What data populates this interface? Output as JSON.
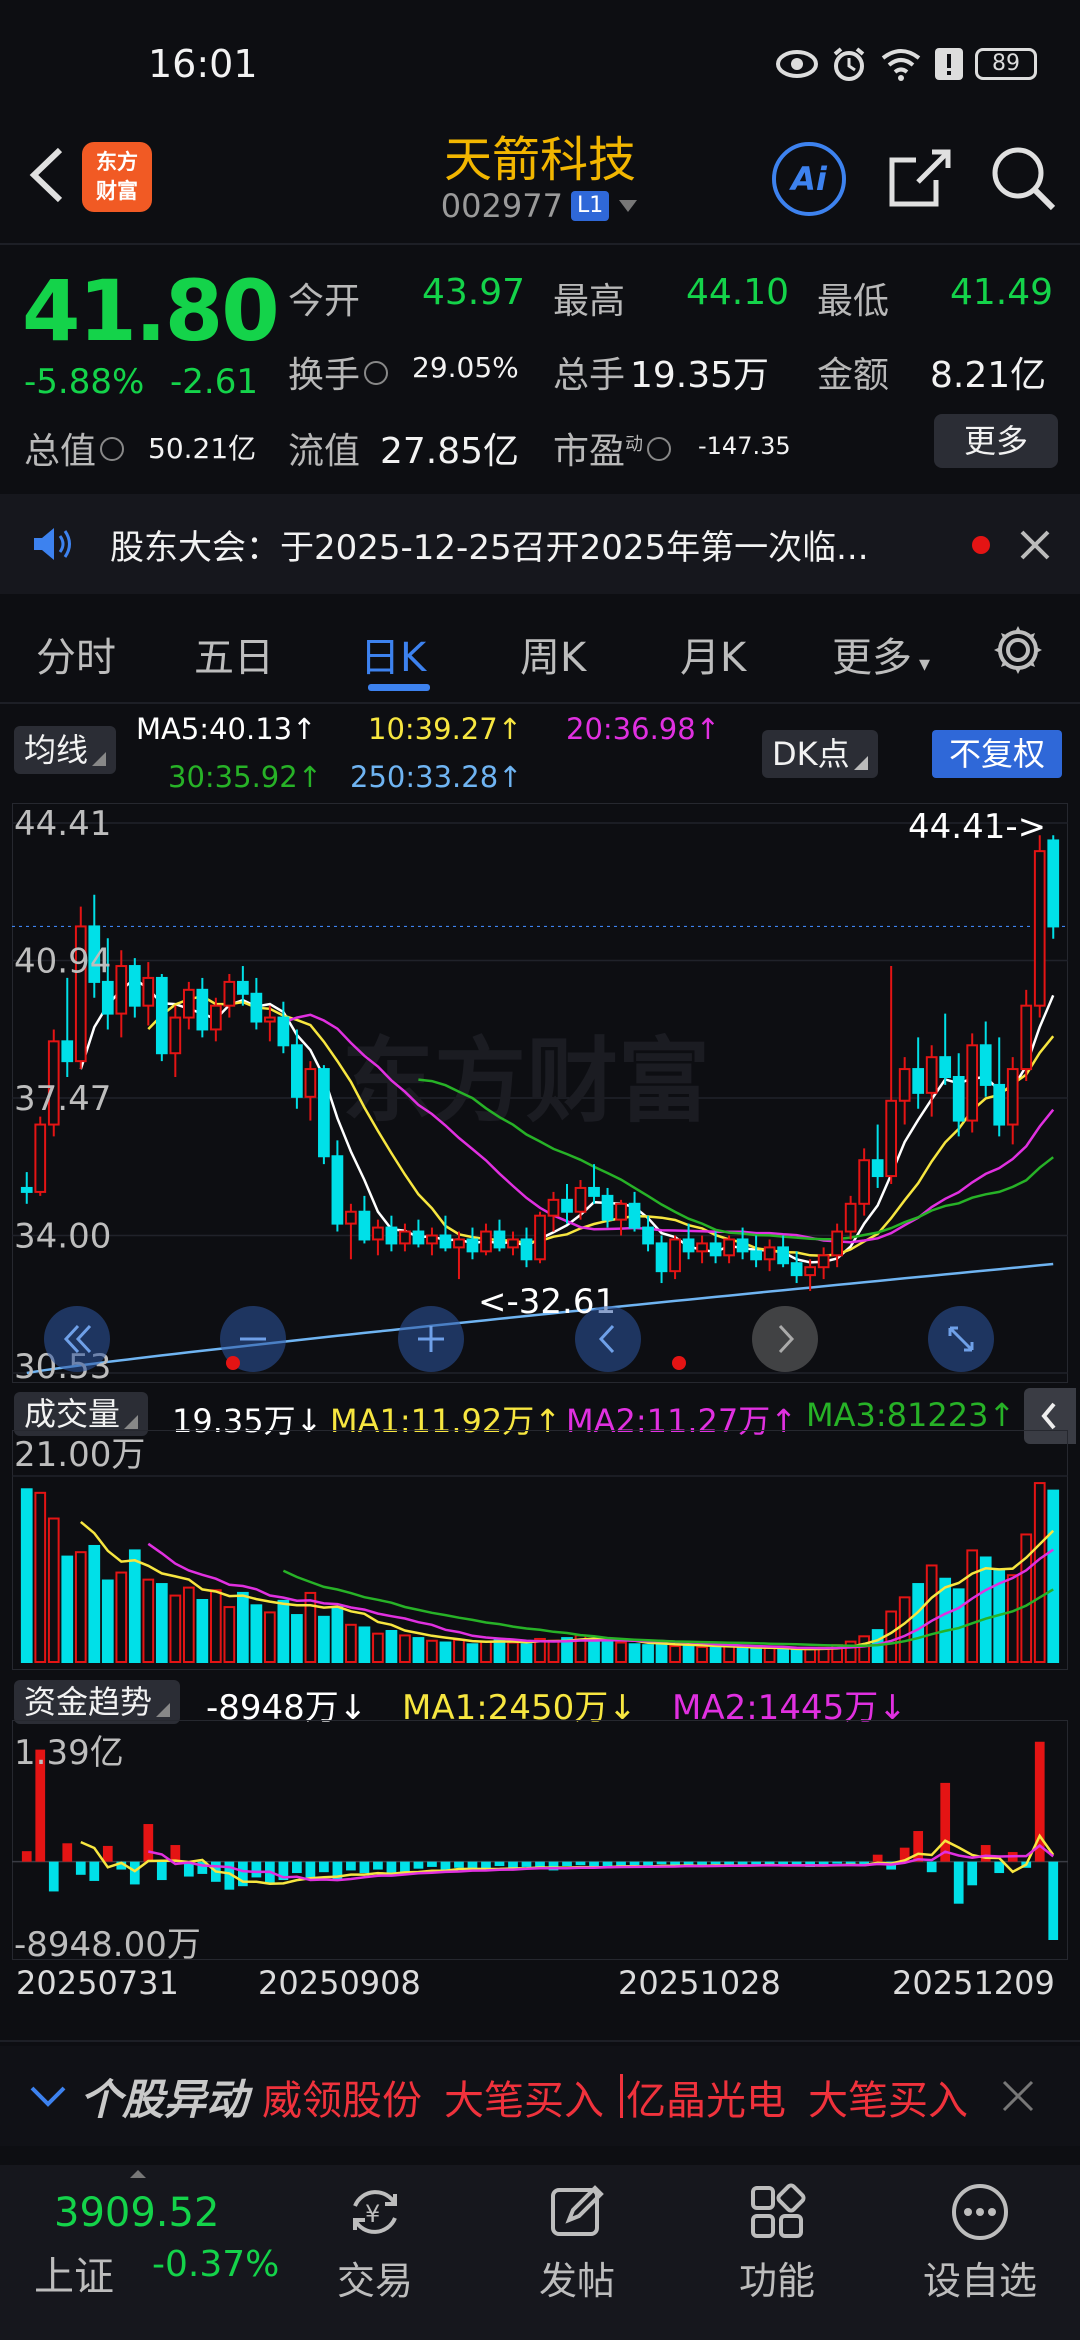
{
  "status": {
    "time": "16:01",
    "battery": "89"
  },
  "header": {
    "stock_name": "天箭科技",
    "stock_code": "002977",
    "level_badge": "L1",
    "logo_line1": "东方",
    "logo_line2": "财富",
    "ai_label": "Ai"
  },
  "quote": {
    "price": "41.80",
    "change_pct": "-5.88%",
    "change": "-2.61",
    "open_label": "今开",
    "open": "43.97",
    "high_label": "最高",
    "high": "44.10",
    "low_label": "最低",
    "low": "41.49",
    "turnover_label": "换手",
    "turnover": "29.05%",
    "volume_label": "总手",
    "volume": "19.35万",
    "amount_label": "金额",
    "amount": "8.21亿",
    "mktcap_label": "总值",
    "mktcap": "50.21亿",
    "float_label": "流值",
    "float_cap": "27.85亿",
    "pe_label": "市盈",
    "pe_sup": "动",
    "pe": "-147.35",
    "more_label": "更多"
  },
  "notice": {
    "text": "股东大会：于2025-12-25召开2025年第一次临..."
  },
  "tabs": [
    "分时",
    "五日",
    "日K",
    "周K",
    "月K",
    "更多"
  ],
  "active_tab": "日K",
  "ma_legend": {
    "selector": "均线",
    "dk_point": "DK点",
    "fq_mode": "不复权",
    "ma5": "MA5:40.13↑",
    "ma10": "10:39.27↑",
    "ma20": "20:36.98↑",
    "ma30": "30:35.92↑",
    "ma250": "250:33.28↑"
  },
  "colors": {
    "up": "#e41414",
    "down": "#00e0e8",
    "ma5": "#ffffff",
    "ma10": "#f7e640",
    "ma20": "#e030e0",
    "ma30": "#27b227",
    "ma250": "#6fb4f2",
    "accent": "#3d82ef",
    "green_text": "#14d34a"
  },
  "chart_data": [
    {
      "type": "candlestick",
      "title": "日K",
      "y_axis_labels": [
        "44.41",
        "40.94",
        "37.47",
        "34.00",
        "30.53"
      ],
      "ylim": [
        30.53,
        44.41
      ],
      "annotations": {
        "high_marker": "44.41->",
        "low_marker": "<-32.61"
      },
      "x_tick_labels": [
        "20250731",
        "20250908",
        "20251028",
        "20251209"
      ],
      "ohlc": [
        [
          35.2,
          35.6,
          34.8,
          35.1
        ],
        [
          35.1,
          37.0,
          35.0,
          36.8
        ],
        [
          36.8,
          39.2,
          36.5,
          38.9
        ],
        [
          38.9,
          40.5,
          38.0,
          38.4
        ],
        [
          38.4,
          42.3,
          38.2,
          41.8
        ],
        [
          41.8,
          42.6,
          40.0,
          40.4
        ],
        [
          40.4,
          41.5,
          39.2,
          39.6
        ],
        [
          39.6,
          41.2,
          39.0,
          40.8
        ],
        [
          40.8,
          41.0,
          39.5,
          39.8
        ],
        [
          39.8,
          40.9,
          39.3,
          40.5
        ],
        [
          40.5,
          40.6,
          38.4,
          38.6
        ],
        [
          38.6,
          39.8,
          38.0,
          39.5
        ],
        [
          39.5,
          40.4,
          39.2,
          40.2
        ],
        [
          40.2,
          40.5,
          39.0,
          39.2
        ],
        [
          39.2,
          40.0,
          38.9,
          39.8
        ],
        [
          39.8,
          40.6,
          39.5,
          40.4
        ],
        [
          40.4,
          40.8,
          39.8,
          40.1
        ],
        [
          40.1,
          40.5,
          39.2,
          39.4
        ],
        [
          39.4,
          39.8,
          38.9,
          39.5
        ],
        [
          39.5,
          39.9,
          38.6,
          38.8
        ],
        [
          38.8,
          39.2,
          37.2,
          37.5
        ],
        [
          37.5,
          38.4,
          36.9,
          38.2
        ],
        [
          38.2,
          38.3,
          35.8,
          36.0
        ],
        [
          36.0,
          36.4,
          34.1,
          34.3
        ],
        [
          34.3,
          34.8,
          33.4,
          34.6
        ],
        [
          34.6,
          35.0,
          33.8,
          33.9
        ],
        [
          33.9,
          34.4,
          33.5,
          34.2
        ],
        [
          34.2,
          34.5,
          33.6,
          33.8
        ],
        [
          33.8,
          34.3,
          33.6,
          34.1
        ],
        [
          34.1,
          34.4,
          33.7,
          33.8
        ],
        [
          33.8,
          34.2,
          33.5,
          34.0
        ],
        [
          34.0,
          34.5,
          33.6,
          33.7
        ],
        [
          33.7,
          34.1,
          32.9,
          33.9
        ],
        [
          33.9,
          34.2,
          33.4,
          33.6
        ],
        [
          33.6,
          34.3,
          33.5,
          34.1
        ],
        [
          34.1,
          34.4,
          33.6,
          33.7
        ],
        [
          33.7,
          34.1,
          33.5,
          33.9
        ],
        [
          33.9,
          34.2,
          33.2,
          33.4
        ],
        [
          33.4,
          34.6,
          33.3,
          34.5
        ],
        [
          34.5,
          35.1,
          34.1,
          34.9
        ],
        [
          34.9,
          35.3,
          34.3,
          34.6
        ],
        [
          34.6,
          35.4,
          34.4,
          35.2
        ],
        [
          35.2,
          35.8,
          34.8,
          35.0
        ],
        [
          35.0,
          35.2,
          34.2,
          34.4
        ],
        [
          34.4,
          34.9,
          34.0,
          34.8
        ],
        [
          34.8,
          35.1,
          34.1,
          34.2
        ],
        [
          34.2,
          34.5,
          33.6,
          33.8
        ],
        [
          33.8,
          34.0,
          32.8,
          33.1
        ],
        [
          33.1,
          34.0,
          32.9,
          33.9
        ],
        [
          33.9,
          34.3,
          33.4,
          33.6
        ],
        [
          33.6,
          34.0,
          33.3,
          33.8
        ],
        [
          33.8,
          34.1,
          33.3,
          33.5
        ],
        [
          33.5,
          34.0,
          33.3,
          33.9
        ],
        [
          33.9,
          34.2,
          33.4,
          33.6
        ],
        [
          33.6,
          34.0,
          33.2,
          33.4
        ],
        [
          33.4,
          33.9,
          33.1,
          33.7
        ],
        [
          33.7,
          34.0,
          33.2,
          33.3
        ],
        [
          33.3,
          33.6,
          32.8,
          33.0
        ],
        [
          33.0,
          33.4,
          32.6,
          33.2
        ],
        [
          33.2,
          33.7,
          32.9,
          33.5
        ],
        [
          33.5,
          34.3,
          33.2,
          34.1
        ],
        [
          34.1,
          35.0,
          33.9,
          34.8
        ],
        [
          34.8,
          36.2,
          34.5,
          35.9
        ],
        [
          35.9,
          36.8,
          35.2,
          35.5
        ],
        [
          35.5,
          40.8,
          35.3,
          37.4
        ],
        [
          37.4,
          38.5,
          36.8,
          38.2
        ],
        [
          38.2,
          39.0,
          37.2,
          37.6
        ],
        [
          37.6,
          38.8,
          37.0,
          38.5
        ],
        [
          38.5,
          39.6,
          37.8,
          38.0
        ],
        [
          38.0,
          38.6,
          36.5,
          36.9
        ],
        [
          36.9,
          39.1,
          36.6,
          38.8
        ],
        [
          38.8,
          39.4,
          37.5,
          37.8
        ],
        [
          37.8,
          39.0,
          36.5,
          36.8
        ],
        [
          36.8,
          38.5,
          36.3,
          38.2
        ],
        [
          38.2,
          40.2,
          37.9,
          39.8
        ],
        [
          39.8,
          44.1,
          39.5,
          43.7
        ],
        [
          43.97,
          44.1,
          41.49,
          41.8
        ]
      ]
    },
    {
      "type": "bar",
      "title": "成交量",
      "legend": [
        "19.35万↓",
        "MA1:11.92万↑",
        "MA2:11.27万↑",
        "MA3:81223↑"
      ],
      "y_axis_labels": [
        "21.00万"
      ],
      "unit": "万",
      "values": [
        19.5,
        19.1,
        16.2,
        11.9,
        12.4,
        13.1,
        9.2,
        10.1,
        12.6,
        9.3,
        8.8,
        7.5,
        8.4,
        7.0,
        8.1,
        6.2,
        7.8,
        6.4,
        5.6,
        6.9,
        5.3,
        7.8,
        5.1,
        6.2,
        4.2,
        3.9,
        3.2,
        3.5,
        3.0,
        2.7,
        2.4,
        2.2,
        2.5,
        2.0,
        2.3,
        2.6,
        2.2,
        2.0,
        2.6,
        2.4,
        2.7,
        3.0,
        2.5,
        2.3,
        2.2,
        2.0,
        1.9,
        2.1,
        1.8,
        1.9,
        1.7,
        1.6,
        1.8,
        1.6,
        1.5,
        1.6,
        1.4,
        1.3,
        1.5,
        1.6,
        1.9,
        2.3,
        2.9,
        3.6,
        5.7,
        7.3,
        8.8,
        10.9,
        9.4,
        8.2,
        12.6,
        11.8,
        10.3,
        9.8,
        14.4,
        20.2,
        19.35
      ]
    },
    {
      "type": "bar",
      "title": "资金趋势",
      "legend": [
        "-8948万↓",
        "MA1:2450万↓",
        "MA2:1445万↓"
      ],
      "y_axis_labels": [
        "1.39亿",
        "-8948.00万"
      ],
      "unit": "万",
      "values": [
        1200,
        12800,
        -3400,
        2100,
        -1500,
        -2200,
        1800,
        -900,
        -2600,
        4300,
        -2100,
        1900,
        -1700,
        -1400,
        -2300,
        -3200,
        -2800,
        -1800,
        -2500,
        -2100,
        -1300,
        -1800,
        -1200,
        -2100,
        -1000,
        -1300,
        -900,
        -1700,
        -1200,
        -800,
        -600,
        -900,
        -700,
        -1100,
        -900,
        -500,
        -700,
        -600,
        -600,
        -1000,
        -500,
        -400,
        -700,
        -500,
        -600,
        -400,
        -600,
        -300,
        -500,
        -400,
        -600,
        -300,
        -400,
        -500,
        -300,
        -400,
        -500,
        -300,
        -600,
        -400,
        -200,
        -300,
        -500,
        800,
        -900,
        1600,
        3500,
        -1200,
        9000,
        -4800,
        -2700,
        1900,
        -1300,
        1100,
        -700,
        13700,
        -8948
      ]
    }
  ],
  "ticker": {
    "title": "个股异动",
    "items": [
      "威领股份",
      "大笔买入",
      "亿晶光电",
      "大笔买入"
    ]
  },
  "bottom_nav": {
    "index_value": "3909.52",
    "index_name": "上证",
    "index_change": "-0.37%",
    "items": [
      "交易",
      "发帖",
      "功能",
      "设自选"
    ]
  }
}
